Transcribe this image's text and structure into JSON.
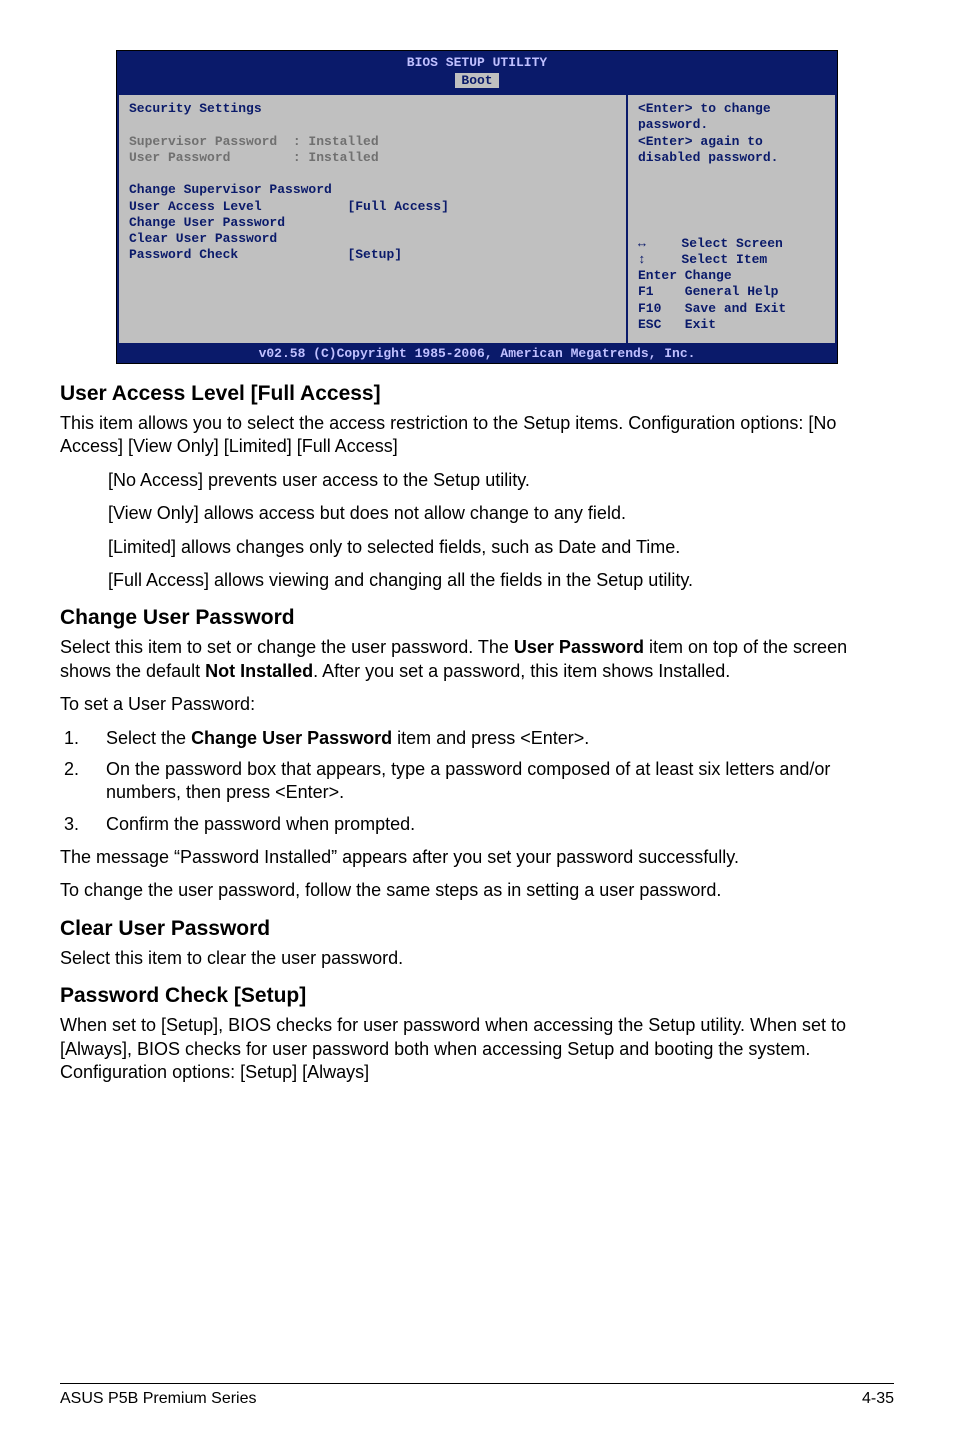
{
  "bios": {
    "title": "BIOS SETUP UTILITY",
    "tab": "Boot",
    "heading": "Security Settings",
    "supervisor_label": "Supervisor Password  : Installed",
    "user_label": "User Password        : Installed",
    "change_sup": "Change Supervisor Password",
    "ual_label": "User Access Level",
    "ual_value": "[Full Access]",
    "change_user": "Change User Password",
    "clear_user": "Clear User Password",
    "pwcheck_label": "Password Check",
    "pwcheck_value": "[Setup]",
    "help1": "<Enter> to change",
    "help2": "password.",
    "help3": "<Enter> again to",
    "help4": "disabled password.",
    "nav_select_screen": "Select Screen",
    "nav_select_item": "Select Item",
    "nav_enter": "Enter Change",
    "nav_f1": "F1    General Help",
    "nav_f10": "F10   Save and Exit",
    "nav_esc": "ESC   Exit",
    "footer": "v02.58 (C)Copyright 1985-2006, American Megatrends, Inc."
  },
  "doc": {
    "ual_heading": "User Access Level [Full Access]",
    "ual_p1": "This item allows you to select the access restriction to the Setup items. Configuration options: [No Access] [View Only] [Limited] [Full Access]",
    "ual_no_access": "[No Access] prevents user access to the Setup utility.",
    "ual_view_only": "[View Only] allows access but does not allow change to any field.",
    "ual_limited": "[Limited] allows changes only to selected fields, such as Date and Time.",
    "ual_full": "[Full Access] allows viewing and changing all the fields in the Setup utility.",
    "cup_heading": "Change User Password",
    "cup_p1a": "Select this item to set or change the user password. The ",
    "cup_p1b": "User Password",
    "cup_p1c": " item on top of the screen shows the default ",
    "cup_p1d": "Not Installed",
    "cup_p1e": ". After you set a password, this item shows Installed.",
    "cup_p2": "To set a User Password:",
    "step1a": "Select the ",
    "step1b": "Change User Password",
    "step1c": " item and press <Enter>.",
    "step2": "On the password box that appears, type a password composed of at least six letters and/or numbers, then press <Enter>.",
    "step3": "Confirm the password when prompted.",
    "cup_p3": "The message “Password Installed” appears after you set your password successfully.",
    "cup_p4": "To change the user password, follow the same steps as in setting a user password.",
    "clr_heading": "Clear User Password",
    "clr_p1": "Select this item to clear the user password.",
    "pw_heading": "Password Check [Setup]",
    "pw_p1": "When set to [Setup], BIOS checks for user password when accessing the Setup utility. When set to [Always], BIOS checks for user password both when accessing Setup and booting the system. Configuration options: [Setup] [Always]",
    "footer_left": "ASUS P5B Premium Series",
    "footer_right": "4-35"
  }
}
